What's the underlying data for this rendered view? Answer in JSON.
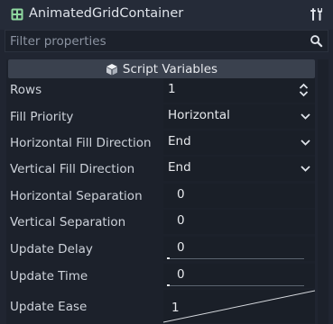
{
  "header": {
    "title": "AnimatedGridContainer",
    "node_icon": "grid-icon",
    "tool_icon": "wrench-screwdriver-icon"
  },
  "filter": {
    "placeholder": "Filter properties",
    "value": ""
  },
  "section": {
    "label": "Script Variables",
    "icon": "cube-icon"
  },
  "properties": {
    "rows": {
      "label": "Rows",
      "value": "1"
    },
    "fill_priority": {
      "label": "Fill Priority",
      "value": "Horizontal"
    },
    "horizontal_fill_direction": {
      "label": "Horizontal Fill Direction",
      "value": "End"
    },
    "vertical_fill_direction": {
      "label": "Vertical Fill Direction",
      "value": "End"
    },
    "horizontal_separation": {
      "label": "Horizontal Separation",
      "value": "0"
    },
    "vertical_separation": {
      "label": "Vertical Separation",
      "value": "0"
    },
    "update_delay": {
      "label": "Update Delay",
      "value": "0",
      "slider_fraction": 0.02
    },
    "update_time": {
      "label": "Update Time",
      "value": "0",
      "slider_fraction": 0.02
    },
    "update_ease": {
      "label": "Update Ease",
      "value": "1"
    }
  },
  "colors": {
    "background": "#202531",
    "field": "#1a1f28",
    "section": "#3a414e",
    "text": "#cdd2da"
  }
}
